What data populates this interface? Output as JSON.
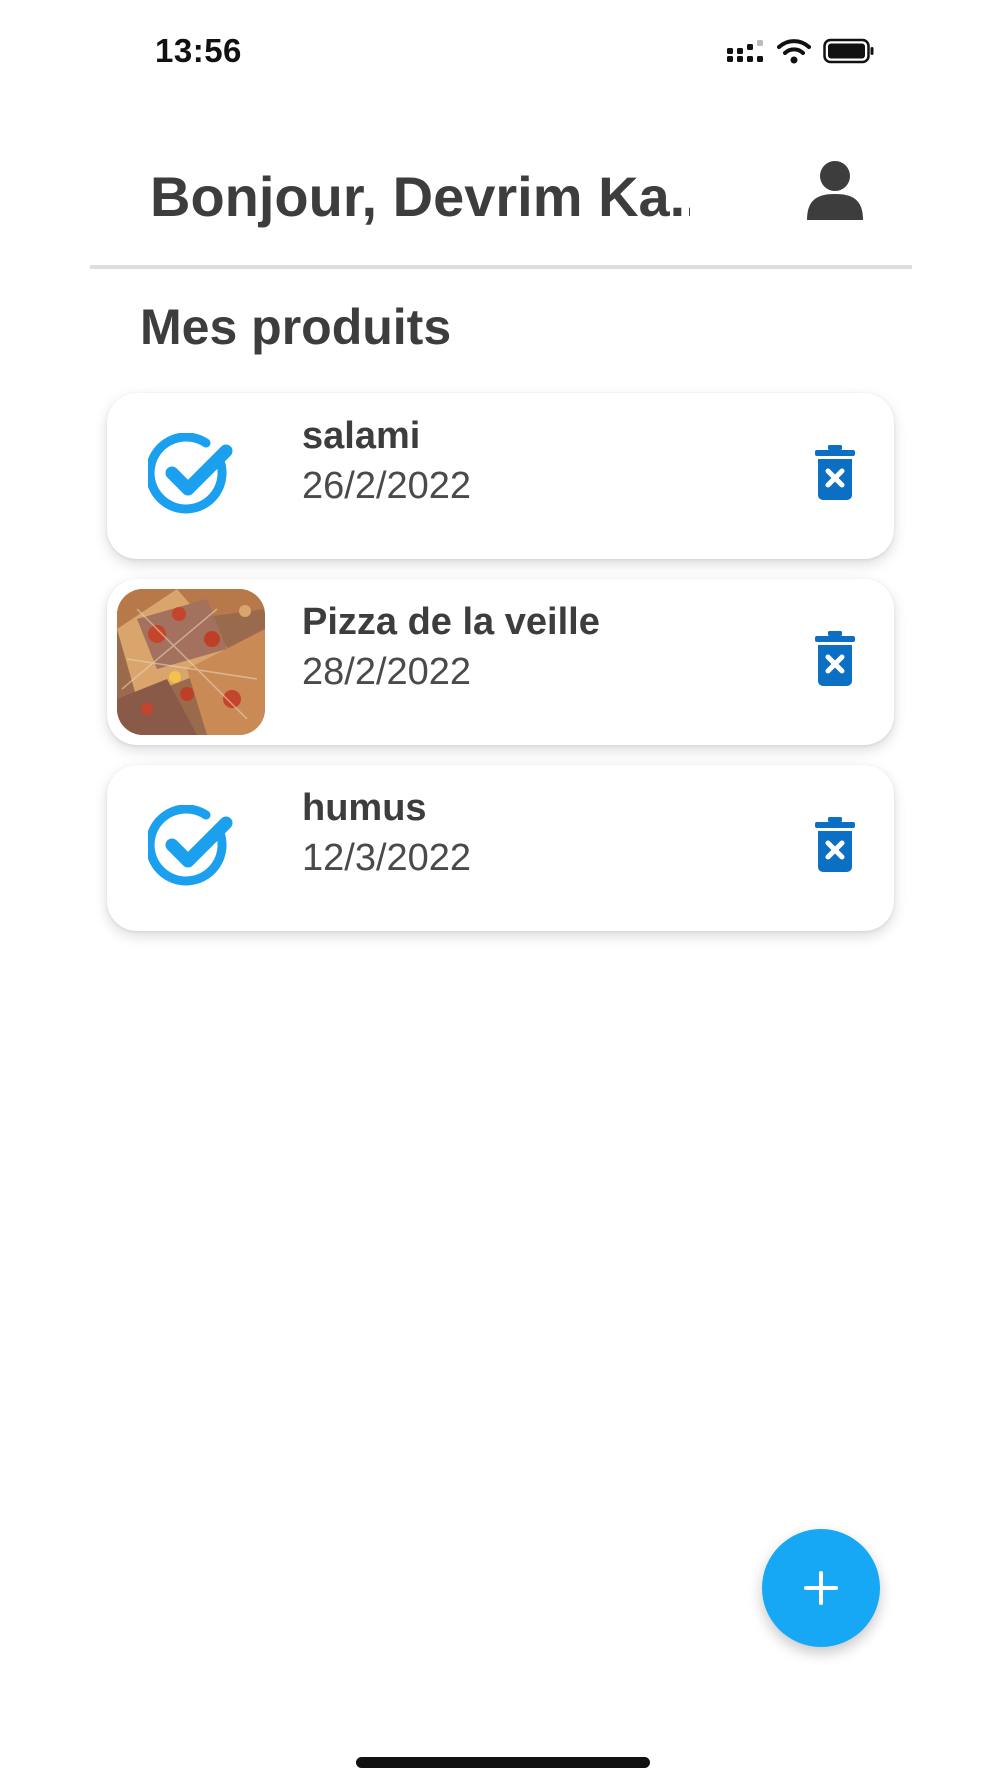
{
  "status_bar": {
    "time": "13:56",
    "icons": [
      "cellular-signal-icon",
      "wifi-icon",
      "battery-icon"
    ]
  },
  "header": {
    "greeting": "Bonjour, Devrim Ka...",
    "profile_icon": "user-icon"
  },
  "section_title": "Mes produits",
  "products": [
    {
      "name": "salami",
      "date": "26/2/2022",
      "media": "check-circle-icon"
    },
    {
      "name": "Pizza de la veille",
      "date": "28/2/2022",
      "media": "pizza-photo"
    },
    {
      "name": "humus",
      "date": "12/3/2022",
      "media": "check-circle-icon"
    }
  ],
  "actions": {
    "delete_icon": "trash-x-icon",
    "add_icon": "plus-icon"
  },
  "colors": {
    "accent": "#17a8f5",
    "check": "#1aa0ee",
    "delete": "#0b6fc3",
    "text": "#3d3d3d"
  }
}
